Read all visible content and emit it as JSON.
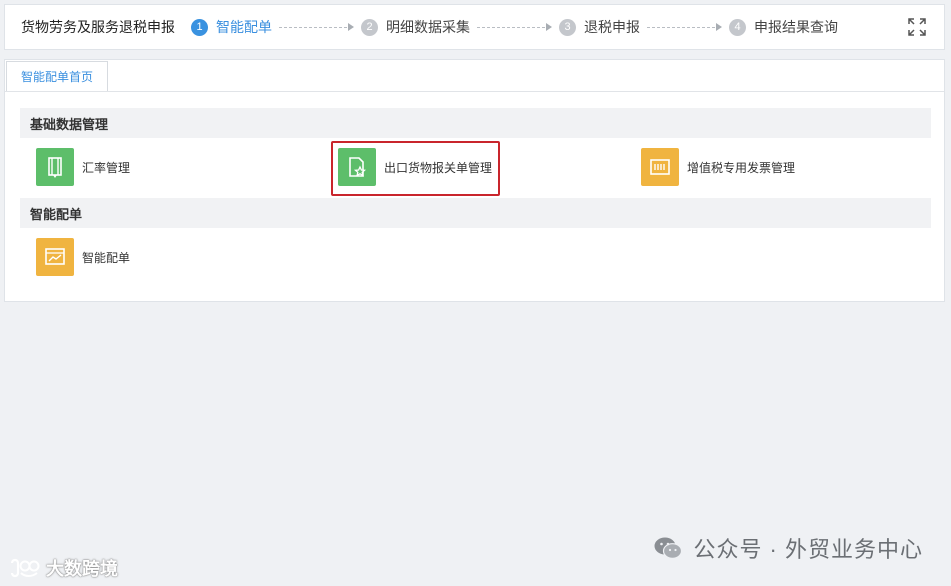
{
  "header": {
    "app_title": "货物劳务及服务退税申报",
    "steps": [
      {
        "num": "1",
        "label": "智能配单",
        "active": true
      },
      {
        "num": "2",
        "label": "明细数据采集",
        "active": false
      },
      {
        "num": "3",
        "label": "退税申报",
        "active": false
      },
      {
        "num": "4",
        "label": "申报结果查询",
        "active": false
      }
    ],
    "fullscreen_icon": "fullscreen-icon"
  },
  "tabs": [
    {
      "label": "智能配单首页",
      "active": true
    }
  ],
  "sections": [
    {
      "title": "基础数据管理",
      "items": [
        {
          "label": "汇率管理",
          "icon": "exchange-doc-icon",
          "color": "#5dbe6a"
        },
        {
          "label": "出口货物报关单管理",
          "icon": "doc-star-icon",
          "color": "#5dbe6a",
          "highlighted": true
        },
        {
          "label": "增值税专用发票管理",
          "icon": "invoice-icon",
          "color": "#f0b440"
        }
      ]
    },
    {
      "title": "智能配单",
      "items": [
        {
          "label": "智能配单",
          "icon": "chart-board-icon",
          "color": "#f0b440"
        }
      ]
    }
  ],
  "colors": {
    "accent": "#3a8fdf",
    "highlight": "#c9252c",
    "green": "#5dbe6a",
    "orange": "#f0b440"
  },
  "watermarks": {
    "right": "公众号 · 外贸业务中心",
    "left": "大数跨境"
  }
}
